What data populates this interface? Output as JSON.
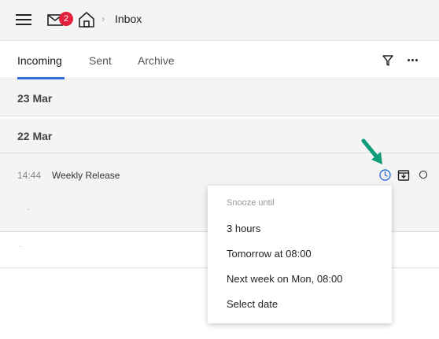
{
  "header": {
    "unread_count": "2",
    "separator": "›",
    "breadcrumb": "Inbox",
    "icons": [
      "menu-icon",
      "mail-icon",
      "home-icon"
    ]
  },
  "tabs": {
    "items": [
      {
        "label": "Incoming",
        "active": true
      },
      {
        "label": "Sent",
        "active": false
      },
      {
        "label": "Archive",
        "active": false
      }
    ],
    "icons": [
      "filter-icon",
      "more-icon"
    ],
    "accent": "#2f6fd6"
  },
  "groups": [
    {
      "date": "23 Mar"
    },
    {
      "date": "22 Mar"
    }
  ],
  "messages": [
    {
      "time": "14:44",
      "subject": "Weekly Release",
      "preview": "-"
    },
    {
      "preview": "-"
    }
  ],
  "snooze_menu": {
    "header": "Snooze until",
    "items": [
      "3 hours",
      "Tomorrow at 08:00",
      "Next week on Mon, 08:00",
      "Select date"
    ]
  },
  "colors": {
    "badge": "#e5203d",
    "snooze_icon": "#2f6fd6",
    "pointer_arrow": "#0f9d7a"
  }
}
